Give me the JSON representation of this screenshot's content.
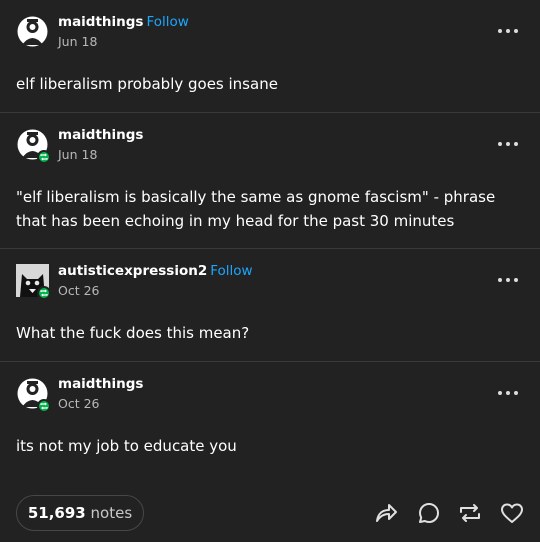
{
  "posts": [
    {
      "username": "maidthings",
      "follow_label": "Follow",
      "date": "Jun 18",
      "content": "elf liberalism probably goes insane",
      "is_reblog": false,
      "avatar": "maid-avatar"
    },
    {
      "username": "maidthings",
      "follow_label": "",
      "date": "Jun 18",
      "content": "\"elf liberalism is basically the same as gnome fascism\" - phrase that has been echoing in my head for the past 30 minutes",
      "is_reblog": true,
      "avatar": "maid-avatar"
    },
    {
      "username": "autisticexpression2",
      "follow_label": "Follow",
      "date": "Oct 26",
      "content": "What the fuck does this mean?",
      "is_reblog": true,
      "avatar": "cat-avatar"
    },
    {
      "username": "maidthings",
      "follow_label": "",
      "date": "Oct 26",
      "content": "its not my job to educate you",
      "is_reblog": true,
      "avatar": "maid-avatar"
    }
  ],
  "footer": {
    "notes_count": "51,693",
    "notes_label": "notes",
    "actions": [
      "share-icon",
      "reply-icon",
      "reblog-icon",
      "like-icon"
    ]
  },
  "colors": {
    "background": "#222222",
    "follow": "#1ca6ff",
    "reblog_badge": "#00b34a",
    "divider": "#3a3a3a"
  }
}
